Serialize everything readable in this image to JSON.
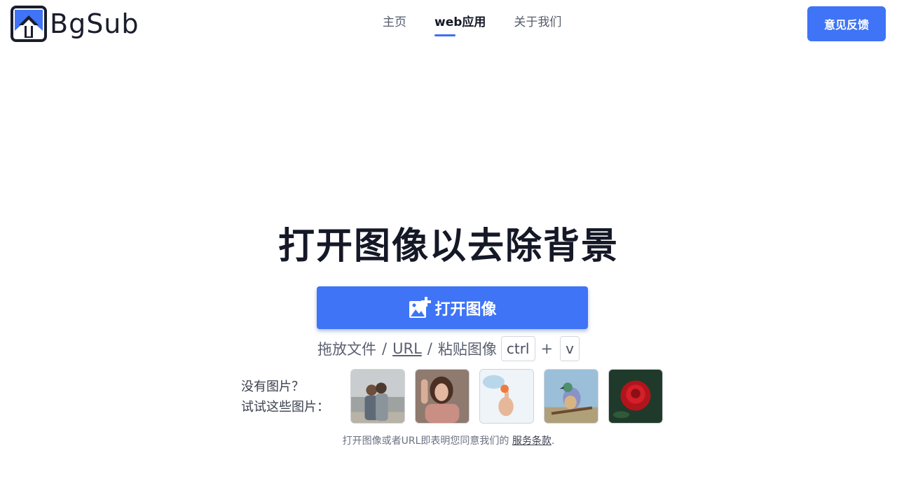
{
  "brand": {
    "name": "BgSub",
    "accent": "#3e74f5"
  },
  "nav": {
    "items": [
      {
        "label": "主页",
        "active": false
      },
      {
        "label": "web应用",
        "active": true
      },
      {
        "label": "关于我们",
        "active": false
      }
    ]
  },
  "header": {
    "feedback_label": "意见反馈"
  },
  "hero": {
    "title": "打开图像以去除背景",
    "open_button_label": "打开图像",
    "hint": {
      "drag": "拖放文件",
      "sep1": "/",
      "url": "URL",
      "sep2": "/",
      "paste": "粘贴图像",
      "key1": "ctrl",
      "plus": "+",
      "key2": "v"
    }
  },
  "samples": {
    "line1": "没有图片？",
    "line2": "试试这些图片：",
    "images": [
      "couple-photo",
      "woman-portrait",
      "hand-holding-object",
      "bird-on-branch",
      "red-rose"
    ]
  },
  "terms": {
    "text": "打开图像或者URL即表明您同意我们的",
    "link": "服务条款",
    "end": "."
  }
}
